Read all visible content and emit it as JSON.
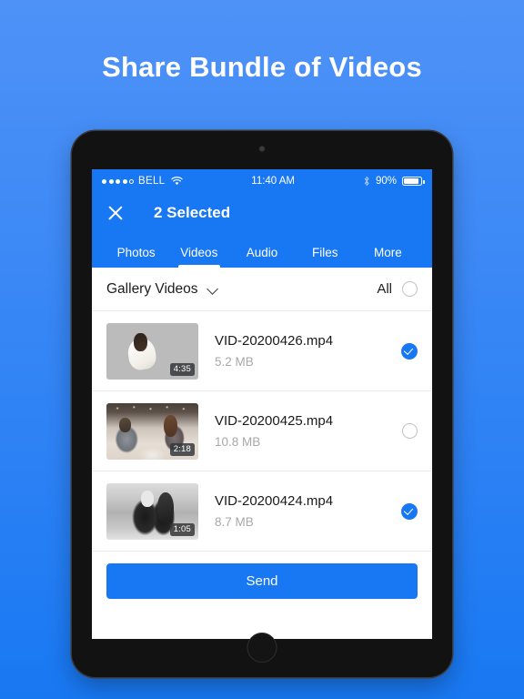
{
  "headline": "Share Bundle of Videos",
  "status_bar": {
    "signal_dots_filled": 4,
    "signal_dots_total": 5,
    "carrier": "BELL",
    "wifi_icon": "wifi-icon",
    "time": "11:40 AM",
    "bluetooth_icon": "bluetooth-icon",
    "battery_percent": "90%"
  },
  "appbar": {
    "close_icon": "close-icon",
    "title": "2 Selected",
    "tabs": [
      {
        "label": "Photos",
        "active": false
      },
      {
        "label": "Videos",
        "active": true
      },
      {
        "label": "Audio",
        "active": false
      },
      {
        "label": "Files",
        "active": false
      },
      {
        "label": "More",
        "active": false
      }
    ]
  },
  "gallery_header": {
    "label": "Gallery Videos",
    "chevron_icon": "chevron-down-icon",
    "all_label": "All",
    "all_selected": false
  },
  "videos": [
    {
      "name": "VID-20200426.mp4",
      "size": "5.2 MB",
      "duration": "4:35",
      "selected": true,
      "thumb": "beach-wedding-thumbnail"
    },
    {
      "name": "VID-20200425.mp4",
      "size": "10.8 MB",
      "duration": "2:18",
      "selected": false,
      "thumb": "couch-couple-thumbnail"
    },
    {
      "name": "VID-20200424.mp4",
      "size": "8.7 MB",
      "duration": "1:05",
      "selected": true,
      "thumb": "bw-embrace-thumbnail"
    }
  ],
  "send_button": "Send",
  "colors": {
    "brand_blue": "#1877f2",
    "background_top": "#4e92f7",
    "background_bottom": "#1878f2",
    "muted_text": "#a8a8a8"
  }
}
